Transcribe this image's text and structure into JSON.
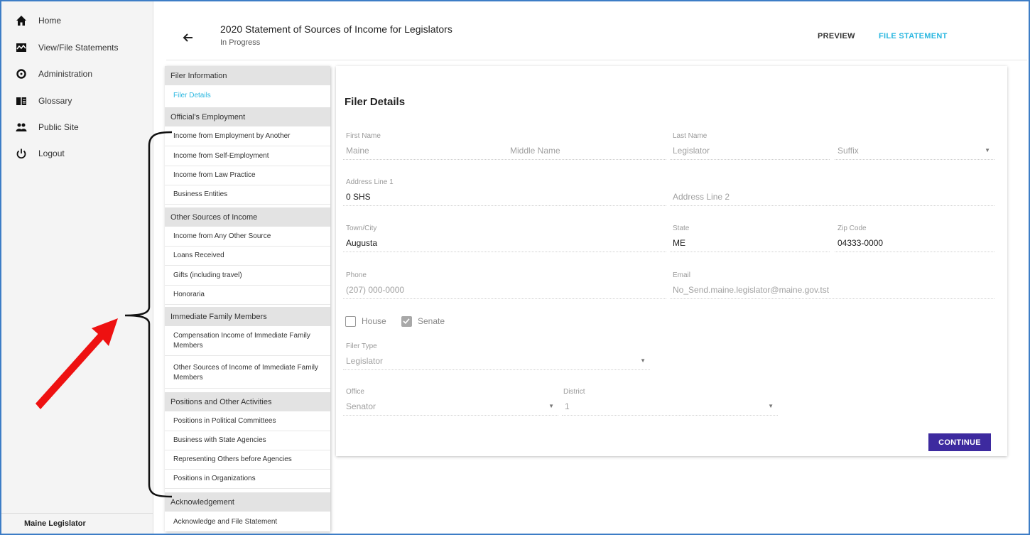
{
  "app": {
    "nav": [
      {
        "label": "Home",
        "icon": "home-icon"
      },
      {
        "label": "View/File Statements",
        "icon": "statements-icon"
      },
      {
        "label": "Administration",
        "icon": "gear-icon"
      },
      {
        "label": "Glossary",
        "icon": "book-icon"
      },
      {
        "label": "Public Site",
        "icon": "people-icon"
      },
      {
        "label": "Logout",
        "icon": "power-icon"
      }
    ],
    "user_name": "Maine Legislator"
  },
  "header": {
    "title": "2020 Statement of Sources of Income for Legislators",
    "status": "In Progress",
    "preview_label": "PREVIEW",
    "file_label": "FILE STATEMENT"
  },
  "sections": {
    "filer_information": {
      "heading": "Filer Information",
      "items": [
        "Filer Details"
      ]
    },
    "officials_employment": {
      "heading": "Official's Employment",
      "items": [
        "Income from Employment by Another",
        "Income from Self-Employment",
        "Income from Law Practice",
        "Business Entities"
      ]
    },
    "other_sources": {
      "heading": "Other Sources of Income",
      "items": [
        "Income from Any Other Source",
        "Loans Received",
        "Gifts (including travel)",
        "Honoraria"
      ]
    },
    "family": {
      "heading": "Immediate Family Members",
      "items": [
        "Compensation Income of Immediate Family Members",
        "Other Sources of Income of Immediate Family Members"
      ]
    },
    "positions": {
      "heading": "Positions and Other Activities",
      "items": [
        "Positions in Political Committees",
        "Business with State Agencies",
        "Representing Others before Agencies",
        "Positions in Organizations"
      ]
    },
    "acknowledgement": {
      "heading": "Acknowledgement",
      "items": [
        "Acknowledge and File Statement"
      ]
    }
  },
  "form": {
    "title": "Filer Details",
    "first_name": {
      "label": "First Name",
      "value": "Maine"
    },
    "middle_name": {
      "placeholder": "Middle Name"
    },
    "last_name": {
      "label": "Last Name",
      "value": "Legislator"
    },
    "suffix": {
      "placeholder": "Suffix"
    },
    "address1": {
      "label": "Address Line 1",
      "value": "0 SHS"
    },
    "address2": {
      "placeholder": "Address Line 2"
    },
    "city": {
      "label": "Town/City",
      "value": "Augusta"
    },
    "state": {
      "label": "State",
      "value": "ME"
    },
    "zip": {
      "label": "Zip Code",
      "value": "04333-0000"
    },
    "phone": {
      "label": "Phone",
      "value": "(207) 000-0000"
    },
    "email": {
      "label": "Email",
      "value": "No_Send.maine.legislator@maine.gov.tst"
    },
    "house": {
      "label": "House",
      "checked": false
    },
    "senate": {
      "label": "Senate",
      "checked": true
    },
    "filer_type": {
      "label": "Filer Type",
      "value": "Legislator"
    },
    "office": {
      "label": "Office",
      "value": "Senator"
    },
    "district": {
      "label": "District",
      "value": "1"
    },
    "continue_label": "CONTINUE"
  },
  "colors": {
    "accent": "#2ab7e0",
    "primary_button": "#3d2a9f",
    "annotation_arrow": "#ee1111",
    "frame": "#3d7dc6"
  }
}
